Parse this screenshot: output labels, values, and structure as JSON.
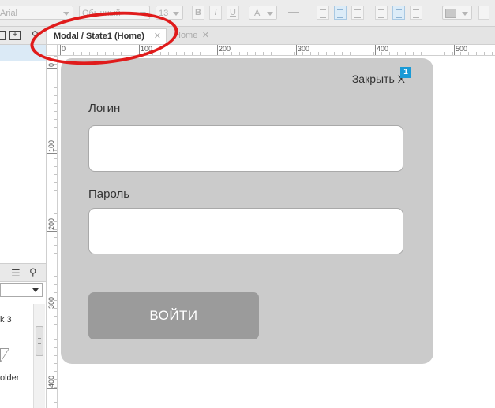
{
  "toolbar": {
    "font_family": "Arial",
    "font_style": "Обычный",
    "font_size": "13",
    "bold": "B",
    "italic": "I",
    "underline": "U",
    "text_color": "A"
  },
  "left_panel": {
    "item_partial_1": "k 3",
    "item_partial_2": "older"
  },
  "tabs": [
    {
      "label": "Modal / State1 (Home)",
      "close": "✕",
      "active": true
    },
    {
      "label": "Home",
      "close": "✕",
      "active": false
    }
  ],
  "ruler": {
    "top": [
      "0",
      "100",
      "200",
      "300",
      "400",
      "500"
    ],
    "left": [
      "0",
      "100",
      "200",
      "300",
      "400"
    ]
  },
  "modal": {
    "close_label": "Закрыть X",
    "badge": "1",
    "login_label": "Логин",
    "login_value": "",
    "password_label": "Пароль",
    "password_value": "",
    "submit_label": "ВОЙТИ"
  },
  "colors": {
    "modal_bg": "#cbcbcb",
    "button_bg": "#9b9b9b",
    "badge_bg": "#1a9ad6",
    "annotation": "#e01b1b"
  }
}
